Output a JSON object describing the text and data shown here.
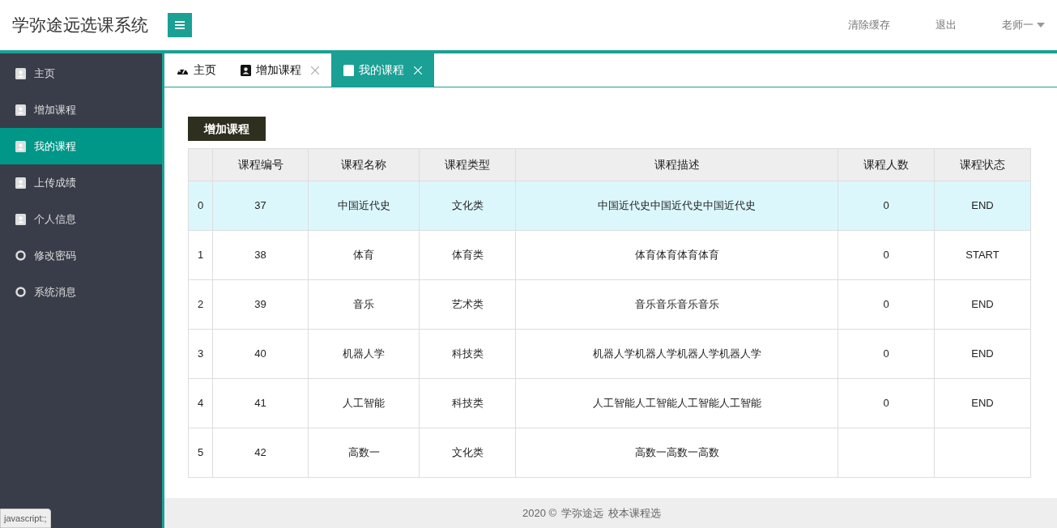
{
  "header": {
    "title": "学弥途远选课系统",
    "links": [
      "清除缓存",
      "退出"
    ],
    "user": "老师一"
  },
  "sidebar": {
    "items": [
      {
        "label": "主页",
        "kind": "card",
        "selected": false
      },
      {
        "label": "增加课程",
        "kind": "card",
        "selected": false
      },
      {
        "label": "我的课程",
        "kind": "card",
        "selected": true
      },
      {
        "label": "上传成绩",
        "kind": "card",
        "selected": false
      },
      {
        "label": "个人信息",
        "kind": "card",
        "selected": false
      },
      {
        "label": "修改密码",
        "kind": "dot",
        "selected": false
      },
      {
        "label": "系统消息",
        "kind": "dot",
        "selected": false
      }
    ]
  },
  "tabs": [
    {
      "label": "主页",
      "kind": "dashboard",
      "closable": false,
      "selected": false
    },
    {
      "label": "增加课程",
      "kind": "card",
      "closable": true,
      "selected": false
    },
    {
      "label": "我的课程",
      "kind": "card",
      "closable": true,
      "selected": true
    }
  ],
  "add_button": "增加课程",
  "table": {
    "columns": [
      "课程编号",
      "课程名称",
      "课程类型",
      "课程描述",
      "课程人数",
      "课程状态"
    ],
    "rows": [
      {
        "index": "0",
        "cells": [
          "37",
          "中国近代史",
          "文化类",
          "中国近代史中国近代史中国近代史",
          "0",
          "END"
        ],
        "selected": true
      },
      {
        "index": "1",
        "cells": [
          "38",
          "体育",
          "体育类",
          "体育体育体育体育",
          "0",
          "START"
        ],
        "selected": false
      },
      {
        "index": "2",
        "cells": [
          "39",
          "音乐",
          "艺术类",
          "音乐音乐音乐音乐",
          "0",
          "END"
        ],
        "selected": false
      },
      {
        "index": "3",
        "cells": [
          "40",
          "机器人学",
          "科技类",
          "机器人学机器人学机器人学机器人学",
          "0",
          "END"
        ],
        "selected": false
      },
      {
        "index": "4",
        "cells": [
          "41",
          "人工智能",
          "科技类",
          "人工智能人工智能人工智能人工智能",
          "0",
          "END"
        ],
        "selected": false
      },
      {
        "index": "5",
        "cells": [
          "42",
          "高数一",
          "文化类",
          "高数一高数一高数"
        ],
        "selected": false
      }
    ]
  },
  "footer": [
    "2020 ©",
    "学弥途远",
    "校本课程选"
  ],
  "status_bar": "javascript:;"
}
